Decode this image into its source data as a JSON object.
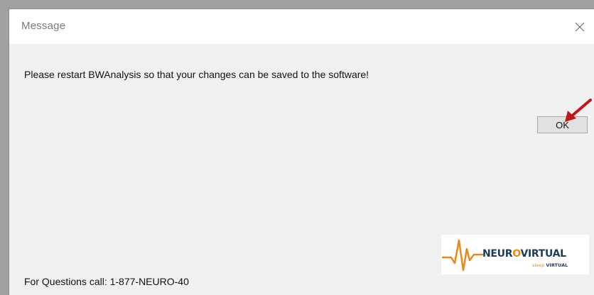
{
  "window": {
    "title": "Message",
    "close_label": "×"
  },
  "message": {
    "text": "Please restart BWAnalysis so that your changes can be saved to the software!"
  },
  "buttons": {
    "ok_label": "OK"
  },
  "footer": {
    "text": "For Questions call: 1-877-NEURO-40"
  },
  "logo": {
    "brand_pre": "NEUR",
    "brand_o": "O",
    "brand_post": "VIRTUAL",
    "tagline_a": "sleep ",
    "tagline_b": "VIRTUAL",
    "brand_color": "#1f3b5c",
    "accent_color": "#e88a1a"
  },
  "annotation": {
    "arrow_color": "#c0161c",
    "icon": "pointer-arrow-icon"
  }
}
